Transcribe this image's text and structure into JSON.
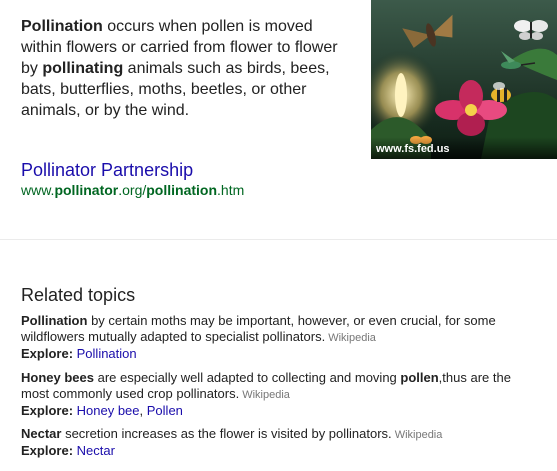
{
  "snippet": {
    "term": "Pollination",
    "text1": " occurs when pollen is moved within flowers or carried from flower to flower by ",
    "term2": "pollinating",
    "text2": " animals such as birds, bees, bats, butterflies, moths, beetles, or other animals, or by the wind."
  },
  "image": {
    "caption": "www.fs.fed.us"
  },
  "source": {
    "title": "Pollinator Partnership",
    "url": {
      "p1": "www.",
      "p2": "pollinator",
      "p3": ".org/",
      "p4": "pollination",
      "p5": ".htm"
    }
  },
  "related": {
    "heading": "Related topics",
    "explore_label": "Explore",
    "wiki_label": "Wikipedia",
    "topics": [
      {
        "term": "Pollination",
        "text": " by certain moths may be important, however, or even crucial, for some wildflowers mutually adapted to specialist pollinators.",
        "links": [
          "Pollination"
        ]
      },
      {
        "term": "Honey bees",
        "text": " are especially well adapted to collecting and moving ",
        "term2": "pollen",
        "text2": ",thus are the most commonly used crop pollinators.",
        "links": [
          "Honey bee",
          "Pollen"
        ],
        "sep": ", "
      },
      {
        "term": "Nectar",
        "text": " secretion increases as the flower is visited by pollinators.",
        "links": [
          "Nectar"
        ]
      }
    ]
  }
}
